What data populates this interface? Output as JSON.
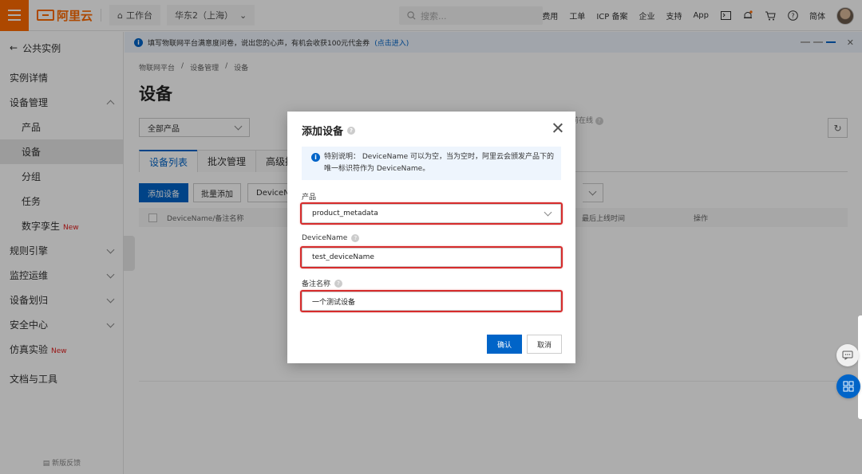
{
  "topbar": {
    "logo_text": "阿里云",
    "workbench": "工作台",
    "region": "华东2（上海）",
    "search_placeholder": "搜索...",
    "links": [
      "费用",
      "工单",
      "ICP 备案",
      "企业",
      "支持",
      "App"
    ],
    "lang": "简体"
  },
  "sidebar": {
    "back_label": "公共实例",
    "items": [
      {
        "label": "实例详情"
      },
      {
        "label": "设备管理"
      },
      {
        "label": "产品"
      },
      {
        "label": "设备"
      },
      {
        "label": "分组"
      },
      {
        "label": "任务"
      },
      {
        "label": "数字孪生",
        "tag": "New"
      },
      {
        "label": "规则引擎"
      },
      {
        "label": "监控运维"
      },
      {
        "label": "设备划归"
      },
      {
        "label": "安全中心"
      },
      {
        "label": "仿真实验",
        "tag": "New"
      },
      {
        "label": "文档与工具"
      }
    ],
    "feedback": "新版反馈"
  },
  "notice": {
    "text": "填写物联网平台满意度问卷，说出您的心声，有机会收获100元代金券",
    "link": "(点击进入)"
  },
  "main": {
    "breadcrumb": [
      "物联网平台",
      "/",
      "设备管理",
      "/",
      "设备"
    ],
    "title": "设备",
    "product_filter": "全部产品",
    "online_text": "前在线",
    "tabs": [
      "设备列表",
      "批次管理",
      "高级搜索"
    ],
    "buttons": {
      "add": "添加设备",
      "batch_add": "批量添加",
      "more": "DeviceNa"
    },
    "table_headers": {
      "name": "DeviceName/备注名称",
      "last_online": "最后上线时间",
      "actions": "操作"
    }
  },
  "dialog": {
    "title": "添加设备",
    "notice_line1": "特别说明： DeviceName 可以为空，当为空时，阿里云会颁发产品下的",
    "notice_line2": "唯一标识符作为 DeviceName。",
    "product_label": "产品",
    "product_value": "product_metadata",
    "devicename_label": "DeviceName",
    "devicename_value": "test_deviceName",
    "remark_label": "备注名称",
    "remark_value": "一个测试设备",
    "ok": "确认",
    "cancel": "取消"
  },
  "colors": {
    "accent": "#0064c8",
    "brand": "#ff6a00",
    "highlight": "#d62c2c",
    "new_tag": "#e02020"
  }
}
